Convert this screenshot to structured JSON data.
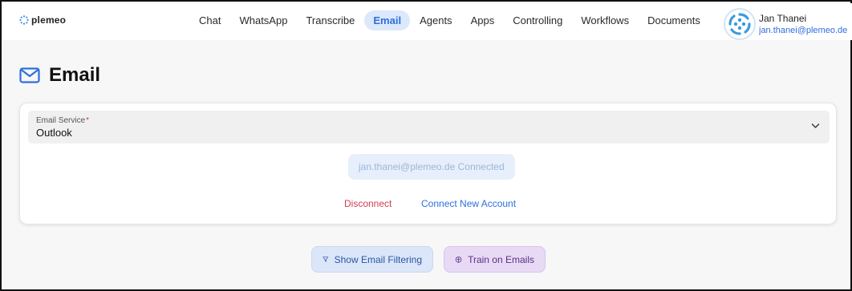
{
  "brand": {
    "name": "plemeo"
  },
  "nav": {
    "items": [
      {
        "label": "Chat",
        "active": false
      },
      {
        "label": "WhatsApp",
        "active": false
      },
      {
        "label": "Transcribe",
        "active": false
      },
      {
        "label": "Email",
        "active": true
      },
      {
        "label": "Agents",
        "active": false
      },
      {
        "label": "Apps",
        "active": false
      },
      {
        "label": "Controlling",
        "active": false
      },
      {
        "label": "Workflows",
        "active": false
      },
      {
        "label": "Documents",
        "active": false
      }
    ]
  },
  "user": {
    "name": "Jan Thanei",
    "email": "jan.thanei@plemeo.de"
  },
  "page": {
    "title": "Email",
    "icon": "mail-icon"
  },
  "email_service": {
    "label": "Email Service",
    "required_mark": "*",
    "value": "Outlook",
    "status": "jan.thanei@plemeo.de Connected",
    "disconnect_label": "Disconnect",
    "connect_new_label": "Connect New Account"
  },
  "actions": {
    "show_filtering_label": "Show Email Filtering",
    "train_label": "Train on Emails"
  },
  "colors": {
    "accent": "#2f6fdc",
    "nav_active_bg": "#dce8fb",
    "danger": "#d23b55",
    "filter_button_bg": "#dbe6f8",
    "train_button_bg": "#e8daf5"
  }
}
